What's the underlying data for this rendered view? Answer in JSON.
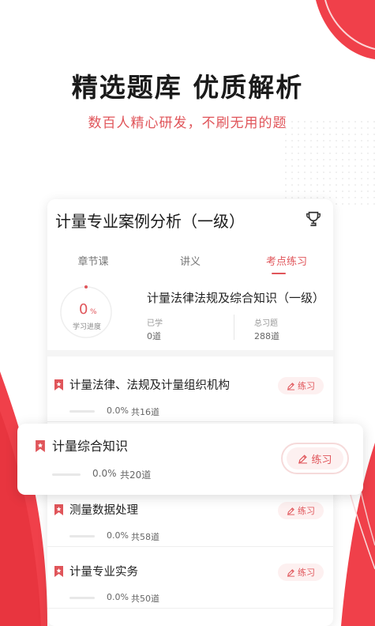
{
  "hero": {
    "headline": "精选题库 优质解析",
    "subhead": "数百人精心研发，不刷无用的题"
  },
  "card": {
    "title": "计量专业案例分析（一级）",
    "tabs": [
      {
        "label": "章节课",
        "active": false
      },
      {
        "label": "讲义",
        "active": false
      },
      {
        "label": "考点练习",
        "active": true
      }
    ],
    "progress": {
      "value": "0",
      "unit": "%",
      "label": "学习进度"
    },
    "summary": {
      "title": "计量法律法规及综合知识（一级）",
      "learned_label": "已学",
      "learned_value": "0道",
      "total_label": "总习题",
      "total_value": "288道"
    },
    "chapters": [
      {
        "title": "计量法律、法规及计量组织机构",
        "percent": "0.0%",
        "total": "共16道",
        "button": "练习"
      },
      {
        "title": "测量数据处理",
        "percent": "0.0%",
        "total": "共58道",
        "button": "练习"
      },
      {
        "title": "计量专业实务",
        "percent": "0.0%",
        "total": "共50道",
        "button": "练习"
      }
    ]
  },
  "floating_item": {
    "title": "计量综合知识",
    "percent": "0.0%",
    "total": "共20道",
    "button": "练习"
  },
  "colors": {
    "accent": "#e0555a",
    "accent_light": "#fdf0f0",
    "background": "#ffffff"
  },
  "icons": {
    "trophy": "trophy-icon",
    "bookmark": "bookmark-icon",
    "pencil": "pencil-icon"
  }
}
